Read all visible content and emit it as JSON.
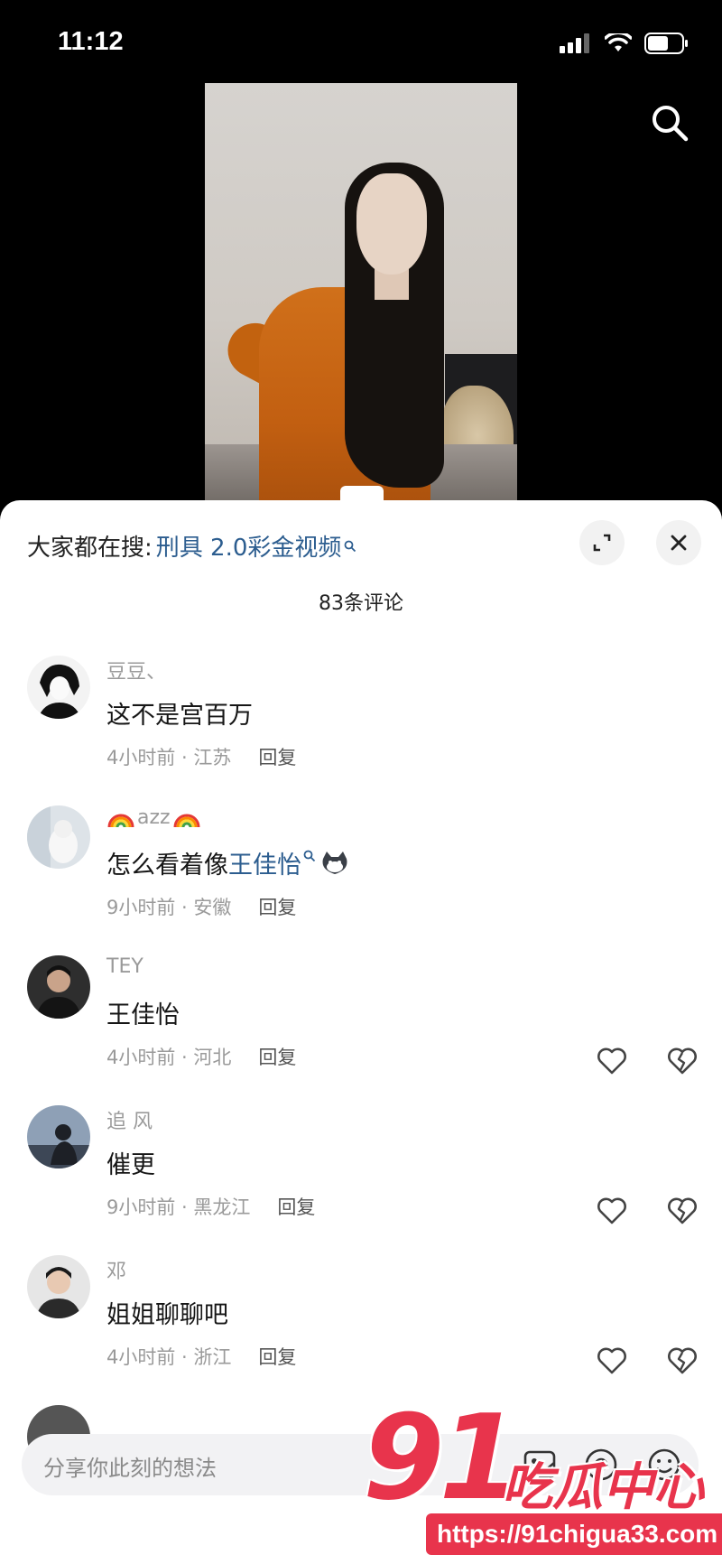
{
  "status_bar": {
    "time": "11:12"
  },
  "hot_search": {
    "prefix": "大家都在搜:",
    "keyword": "刑具 2.0彩金视频"
  },
  "comment_count": "83条评论",
  "comments": [
    {
      "name": "豆豆、",
      "text": "这不是宫百万",
      "time_location": "4小时前 · 江苏",
      "reply": "回复",
      "show_actions": false
    },
    {
      "name": "azz",
      "text_prefix": "怎么看着像",
      "text_link": "王佳怡",
      "time_location": "9小时前 · 安徽",
      "reply": "回复",
      "show_actions": false
    },
    {
      "name": "TEY",
      "text": "王佳怡",
      "time_location": "4小时前 · 河北",
      "reply": "回复",
      "show_actions": true
    },
    {
      "name": "追 风",
      "text": "催更",
      "time_location": "9小时前 · 黑龙江",
      "reply": "回复",
      "show_actions": true
    },
    {
      "name": "邓",
      "text": "姐姐聊聊吧",
      "time_location": "4小时前 · 浙江",
      "reply": "回复",
      "show_actions": true
    }
  ],
  "input": {
    "placeholder": "分享你此刻的想法"
  },
  "watermark": {
    "brand_number": "91",
    "brand_text": "吃瓜中心",
    "url": "https://91chigua33.com"
  },
  "colors": {
    "link": "#2c5d8f",
    "watermark": "#e8344c"
  }
}
